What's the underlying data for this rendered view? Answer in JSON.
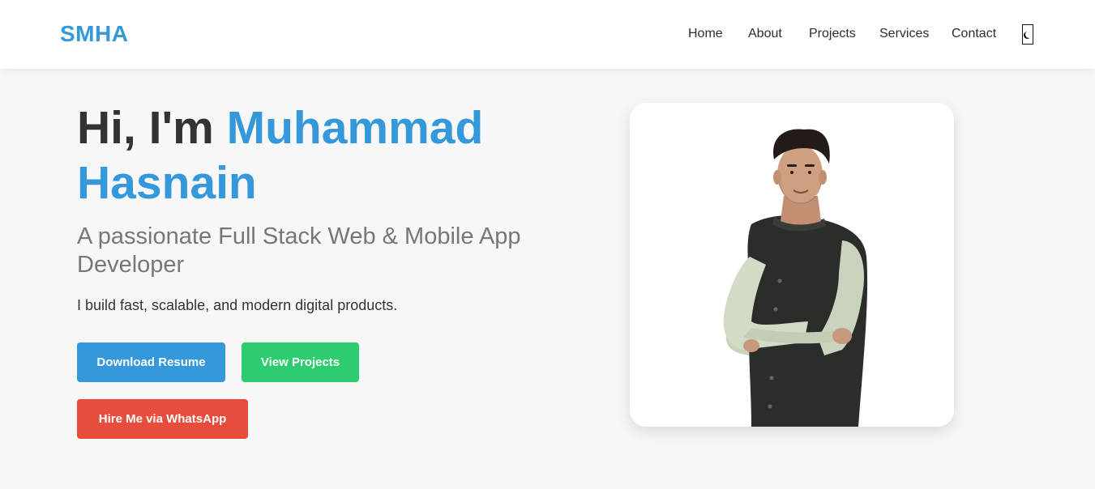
{
  "navbar": {
    "logo": "SMHA",
    "links": [
      {
        "label": "Home"
      },
      {
        "label": "About"
      },
      {
        "label": "Projects"
      },
      {
        "label": "Services"
      },
      {
        "label": "Contact"
      }
    ],
    "theme_toggle_icon": "moon-icon"
  },
  "hero": {
    "greeting": "Hi, I'm",
    "name": "Muhammad Hasnain",
    "subtitle": "A passionate Full Stack Web & Mobile App Developer",
    "description": "I build fast, scalable, and modern digital products.",
    "buttons": {
      "resume": "Download Resume",
      "projects": "View Projects",
      "whatsapp": "Hire Me via WhatsApp"
    }
  },
  "colors": {
    "accent": "#3498db",
    "success": "#2ecc71",
    "danger": "#e74c3c",
    "background": "#f7f7f7"
  }
}
